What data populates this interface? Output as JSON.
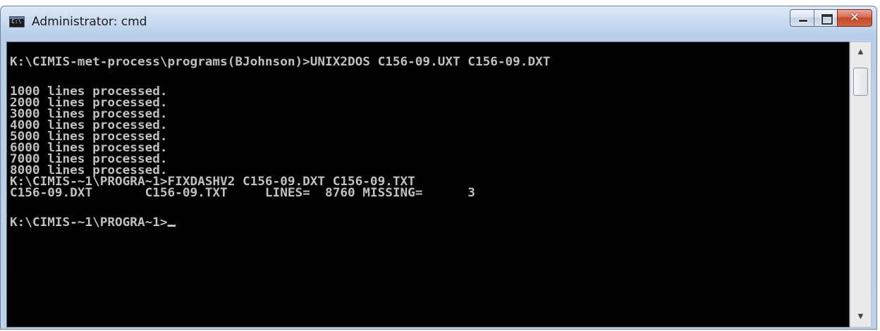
{
  "window": {
    "title": "Administrator: cmd",
    "app_icon": "C:\\",
    "icons": {
      "app": "cmd-icon",
      "minimize": "minimize-icon",
      "maximize": "maximize-icon",
      "close": "close-icon"
    },
    "close_glyph": "✕"
  },
  "console": {
    "lines": [
      "K:\\CIMIS-met-process\\programs(BJohnson)>UNIX2DOS C156-09.UXT C156-09.DXT",
      "",
      "1000 lines processed.",
      "2000 lines processed.",
      "3000 lines processed.",
      "4000 lines processed.",
      "5000 lines processed.",
      "6000 lines processed.",
      "7000 lines processed.",
      "8000 lines processed.",
      "K:\\CIMIS-~1\\PROGRA~1>FIXDASHV2 C156-09.DXT C156-09.TXT",
      "C156-09.DXT       C156-09.TXT     LINES=  8760 MISSING=      3",
      "",
      "K:\\CIMIS-~1\\PROGRA~1>"
    ],
    "colors": {
      "background": "#000000",
      "foreground": "#c0c0c0"
    }
  },
  "scrollbar": {
    "up_arrow": "▲",
    "down_arrow": "▼"
  }
}
